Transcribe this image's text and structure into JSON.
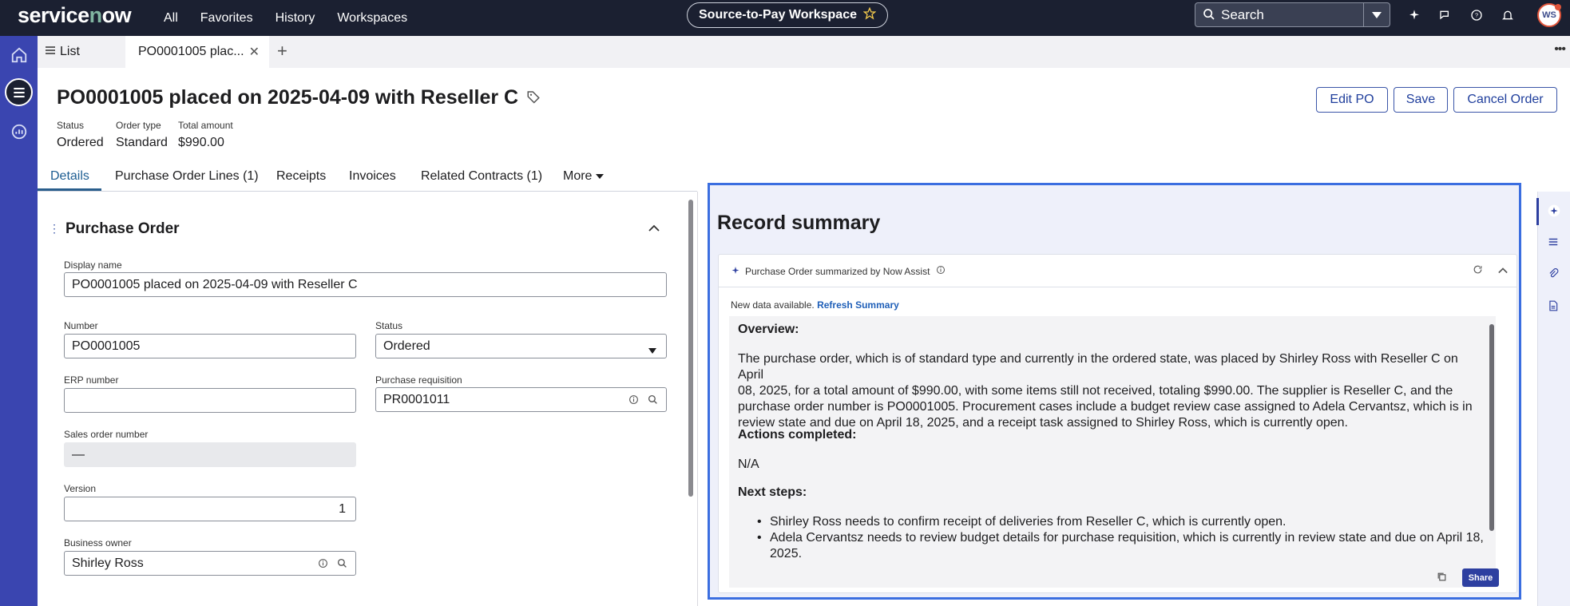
{
  "topbar": {
    "logo": "servicenow",
    "nav": [
      "All",
      "Favorites",
      "History",
      "Workspaces"
    ],
    "workspace_name": "Source-to-Pay Workspace",
    "search_placeholder": "Search",
    "avatar_initials": "WS"
  },
  "tabs": {
    "list_label": "List",
    "active_tab": "PO0001005 plac..."
  },
  "record": {
    "title": "PO0001005 placed on 2025-04-09 with Reseller C",
    "meta": [
      {
        "label": "Status",
        "value": "Ordered"
      },
      {
        "label": "Order type",
        "value": "Standard"
      },
      {
        "label": "Total amount",
        "value": "$990.00"
      }
    ],
    "actions": {
      "edit": "Edit PO",
      "save": "Save",
      "cancel": "Cancel Order"
    }
  },
  "subtabs": [
    "Details",
    "Purchase Order Lines (1)",
    "Receipts",
    "Invoices",
    "Related Contracts (1)",
    "More"
  ],
  "form": {
    "section_title": "Purchase Order",
    "display_name_label": "Display name",
    "display_name": "PO0001005 placed on 2025-04-09 with Reseller C",
    "number_label": "Number",
    "number": "PO0001005",
    "status_label": "Status",
    "status": "Ordered",
    "erp_label": "ERP number",
    "erp": "",
    "pr_label": "Purchase requisition",
    "pr": "PR0001011",
    "sales_order_label": "Sales order number",
    "sales_order": "—",
    "version_label": "Version",
    "version": "1",
    "owner_label": "Business owner",
    "owner": "Shirley Ross"
  },
  "summary": {
    "panel_title": "Record summary",
    "card_title": "Purchase Order summarized by Now Assist",
    "new_data_text": "New data available.",
    "refresh_link": "Refresh Summary",
    "overview_heading": "Overview:",
    "overview_lines": [
      "The purchase order, which is of standard type and currently in the ordered state, was placed by Shirley Ross with Reseller C on April",
      "08, 2025, for a total amount of $990.00, with some items still not received, totaling $990.00. The supplier is Reseller C, and the",
      "purchase order number is PO0001005. Procurement cases include a budget review case assigned to Adela Cervantsz, which is in",
      "review state and due on April 18, 2025, and a receipt task assigned to Shirley Ross, which is currently open."
    ],
    "actions_heading": "Actions completed:",
    "actions_text": "N/A",
    "next_heading": "Next steps:",
    "next_steps": [
      [
        "Shirley Ross needs to confirm receipt of deliveries from Reseller C, which is currently open."
      ],
      [
        "Adela Cervantsz needs to review budget details for purchase requisition, which is currently in review state and due on April 18,",
        "2025."
      ]
    ],
    "share_label": "Share"
  },
  "colors": {
    "topbar": "#1b2031",
    "left_rail": "#3a45b0",
    "accent": "#1f3e9c",
    "highlight_border": "#3b6ee0"
  }
}
